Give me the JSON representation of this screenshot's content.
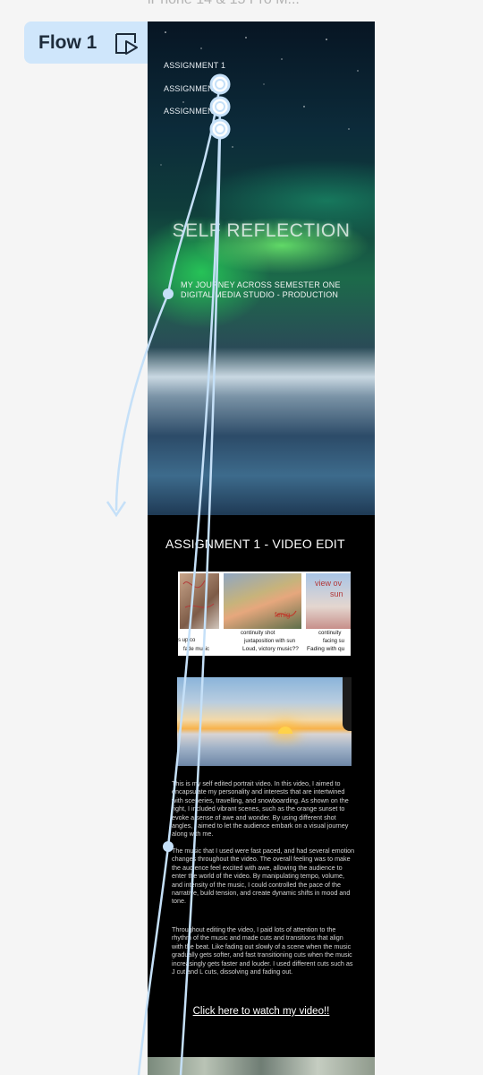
{
  "frame": {
    "title": "iPhone 14 & 15 Pro M..."
  },
  "flow": {
    "label": "Flow 1",
    "play_icon": "play-frame-icon"
  },
  "hero": {
    "nav": [
      "ASSIGNMENT 1",
      "ASSIGNMENT",
      "ASSIGNMENT"
    ],
    "title": "SELF REFLECTION",
    "subtitle_line1": "MY JOURNEY ACROSS SEMESTER ONE",
    "subtitle_line2": "DIGITAL MEDIA STUDIO - PRODUCTION"
  },
  "assignment": {
    "heading": "ASSIGNMENT 1 - VIDEO EDIT",
    "storyboard": {
      "cells": [
        {
          "shot": "",
          "action": "",
          "sound": "s up co",
          "sound2": "fade  music"
        },
        {
          "shot": "continuity shot",
          "action": "juxtaposition with sun",
          "sound": "Loud, victory music??"
        },
        {
          "shot": "continuity",
          "action": "facing su",
          "sound": "Fading with qu"
        }
      ],
      "handwriting": [
        "fenig",
        "view ov",
        "sun"
      ]
    },
    "paragraphs": [
      "This is my self edited portrait video. In this video, I aimed to encapsulate my personality and interests that are intertwined with sceneries, travelling, and snowboarding. As shown on the right, I included vibrant scenes, such as the orange sunset to evoke a sense of awe and wonder. By using different shot angles, I aimed to let the audience embark on a visual journey along with me.",
      "The music that I used were fast paced, and had several emotion changes throughout the video. The overall feeling was to make the audience feel excited with awe, allowing the audience to enter the world of the video. By manipulating tempo, volume, and intensity of the music, I could controlled the pace of the narrative, build tension, and create dynamic shifts in mood and tone.",
      "Throughout editing the video, I paid lots of attention to the rhythm of the music and made cuts and transitions that align with the beat. Like fading out slowly of a scene when the music gradually gets softer, and fast transitioning cuts when the music increasingly gets faster and louder. I used different cuts such as J cut and L cuts, dissolving and fading out."
    ],
    "watch_link": "Click here to watch my video!!"
  },
  "colors": {
    "flow_chip_bg": "#cfe6fb",
    "flow_line": "#c5e0f8",
    "canvas_bg": "#f5f5f5",
    "page_bg": "#000000"
  }
}
